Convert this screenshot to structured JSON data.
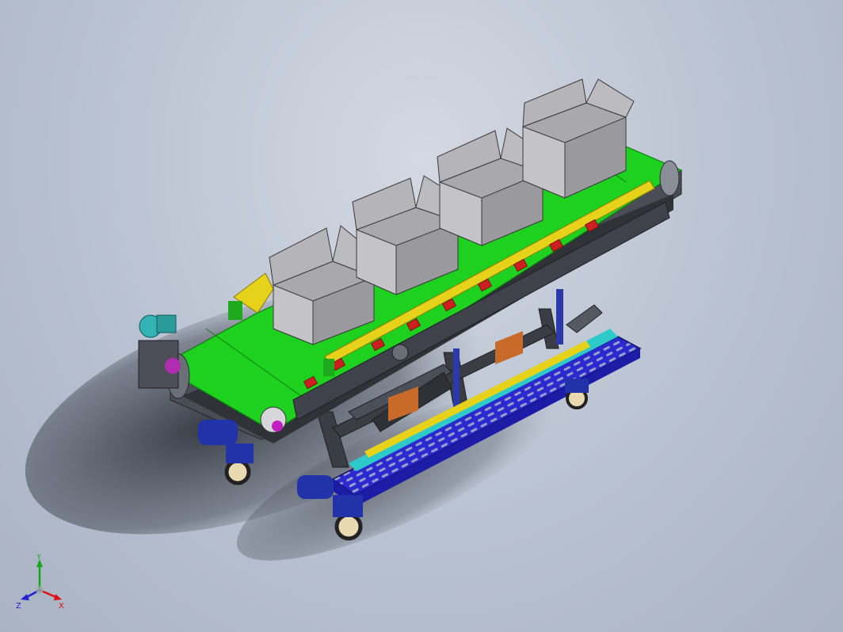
{
  "viewport": {
    "background_top": "#d3d8e2",
    "background_bottom": "#aab3c4"
  },
  "model": {
    "belt_color": "#1fd11f",
    "frame_color": "#3a3d44",
    "yellow_guard_color": "#e6d21a",
    "walkway_color": "#2222c8",
    "caster_color": "#2233aa",
    "roller_color": "#cc1f1f",
    "box_color": "#a9a9ad",
    "motor_color": "#33b3b3",
    "cardboard_box_count": 4
  },
  "triad": {
    "x_label": "X",
    "y_label": "Y",
    "z_label": "Z",
    "x_color": "#d11",
    "y_color": "#1a1",
    "z_color": "#22c"
  }
}
